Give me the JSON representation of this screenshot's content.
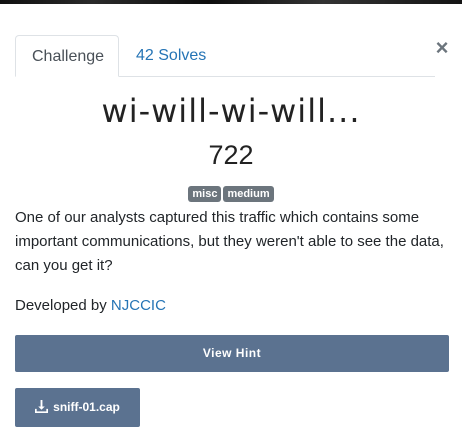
{
  "modal": {
    "close_label": "×",
    "tabs": [
      {
        "label": "Challenge"
      },
      {
        "label": "42 Solves"
      }
    ]
  },
  "challenge": {
    "title": "wi-will-wi-will...",
    "points": "722",
    "tags": [
      "misc",
      "medium"
    ],
    "description": "One of our analysts captured this traffic which contains some important communications, but they weren't able to see the data, can you get it?",
    "developed_by_prefix": "Developed by ",
    "developer": "NJCCIC",
    "hint_button": "View Hint",
    "file_name": "sniff-01.cap"
  },
  "colors": {
    "link": "#2574b5",
    "button": "#5b7290",
    "tag": "#6c757d"
  },
  "icons": {
    "file": "download-icon"
  }
}
